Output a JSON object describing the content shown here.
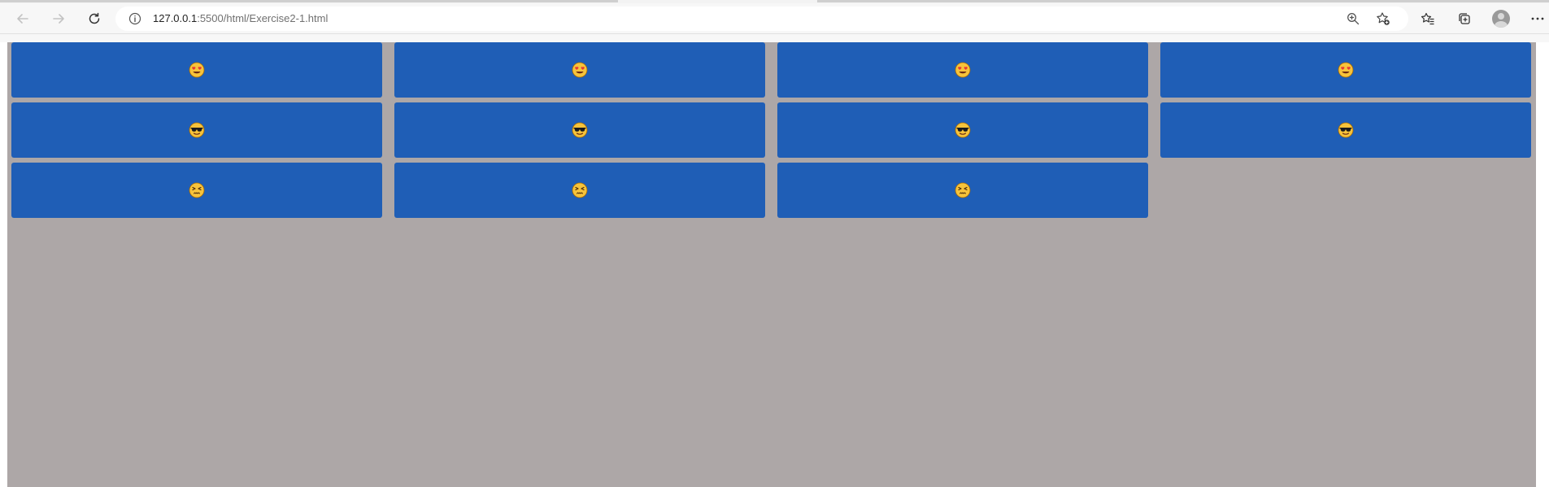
{
  "browser": {
    "url_host": "127.0.0.1",
    "url_path": ":5500/html/Exercise2-1.html",
    "icons": {
      "back": "back-arrow-icon",
      "forward": "forward-arrow-icon",
      "refresh": "refresh-icon",
      "info": "info-icon",
      "zoom": "zoom-icon",
      "add_favorite": "add-favorite-icon",
      "favorites": "favorites-icon",
      "collections": "collections-icon",
      "profile": "profile-avatar",
      "menu": "more-menu-icon"
    }
  },
  "page": {
    "background": "#ada7a7",
    "card_color": "#1f5eb6",
    "rows": [
      {
        "emoji": "heart-eyes",
        "count": 4
      },
      {
        "emoji": "sunglasses",
        "count": 4
      },
      {
        "emoji": "confounded",
        "count": 3
      }
    ]
  }
}
